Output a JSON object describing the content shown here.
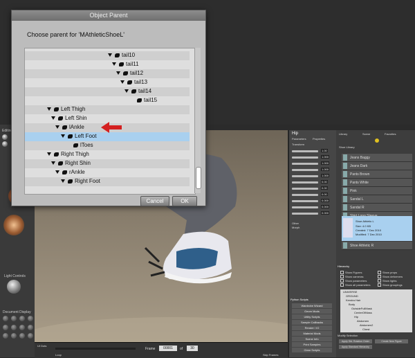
{
  "dialog": {
    "title": "Object Parent",
    "prompt": "Choose parent for 'MAthleticShoeL'",
    "cancel_label": "Cancel",
    "ok_label": "OK",
    "tree_items": [
      {
        "label": "tail10",
        "expanded": true
      },
      {
        "label": "tail11",
        "expanded": true
      },
      {
        "label": "tail12",
        "expanded": true
      },
      {
        "label": "tail13",
        "expanded": true
      },
      {
        "label": "tail14",
        "expanded": true
      },
      {
        "label": "tail15",
        "expanded": false
      },
      {
        "label": "Left Thigh",
        "expanded": true
      },
      {
        "label": "Left Shin",
        "expanded": true
      },
      {
        "label": "lAnkle",
        "expanded": true
      },
      {
        "label": "Left Foot",
        "expanded": true,
        "selected": true
      },
      {
        "label": "lToes",
        "expanded": false
      },
      {
        "label": "Right Thigh",
        "expanded": true
      },
      {
        "label": "Right Shin",
        "expanded": true
      },
      {
        "label": "rAnkle",
        "expanded": true
      },
      {
        "label": "Right Foot",
        "expanded": true
      }
    ],
    "selection_color": "#a9d0ef",
    "arrow_color": "#d42020"
  },
  "left_panel": {
    "editing_label": "Editing",
    "light_controls_label": "Light Controls",
    "document_display_label": "Document Display"
  },
  "params_panel": {
    "title": "Hip",
    "tabs": [
      "Parameters",
      "Properties"
    ],
    "section": "Transform",
    "values": [
      "1.00",
      "1.000",
      "1.000",
      "1.000",
      "1.000",
      "0.00",
      "0.00",
      "0.00",
      "0.000",
      "0.000",
      "0.000"
    ],
    "footer": [
      "Other",
      "Morph"
    ]
  },
  "library_panel": {
    "tabs": [
      "Library",
      "Scene",
      "Favorites"
    ],
    "category": "Shoe Library",
    "items": [
      "Jeans Baggy",
      "Jeans Dark",
      "Pants Brown",
      "Pants White",
      "Pink",
      "Sandal L",
      "Sandal R",
      "Shirt Long Sleeve"
    ],
    "selected_item": {
      "name": "Shoe Athletic L",
      "size_label": "Size:",
      "size": "4.0 KB",
      "created_label": "Created:",
      "created": "7 Dec 2010",
      "modified_label": "Modified:",
      "modified": "7 Dec 2010"
    },
    "next_item": "Shoe Athletic R"
  },
  "hierarchy": {
    "title": "Hierarchy",
    "options_left": [
      "Show Figures",
      "Show cameras",
      "Show parameters",
      "Show all parameters"
    ],
    "options_right": [
      "Show props",
      "Show deformers",
      "Show lights",
      "Show groupings"
    ],
    "tree": [
      "UNIVERSE",
      "GROUND",
      "Kendra Hair",
      "Body",
      "OutsideFullMask",
      "CenterOfMass",
      "Hip",
      "Abdomen",
      "Abdomen2",
      "Chest"
    ],
    "modify_label": "Modify Selection",
    "buttons": [
      "Apply Std. Rotation Order",
      "Create New Figure",
      "Apply Standard Hierarchy"
    ]
  },
  "python_scripts": {
    "title": "Python Scripts",
    "items": [
      "Wardrobe Wizard",
      "Geom Mods",
      "Utility Scripts",
      "Sample Callbacks",
      "Render / IO",
      "Material Mods",
      "Scene Info",
      "Print Samples",
      "Clear Scripts"
    ]
  },
  "timeline": {
    "ui_dots_label": "UI Dots",
    "frame_label": "Frame",
    "frame_value": "00001",
    "of_label": "of",
    "total_frames": "30",
    "loop_label": "Loop",
    "skip_frames_label": "Skip Frames"
  }
}
